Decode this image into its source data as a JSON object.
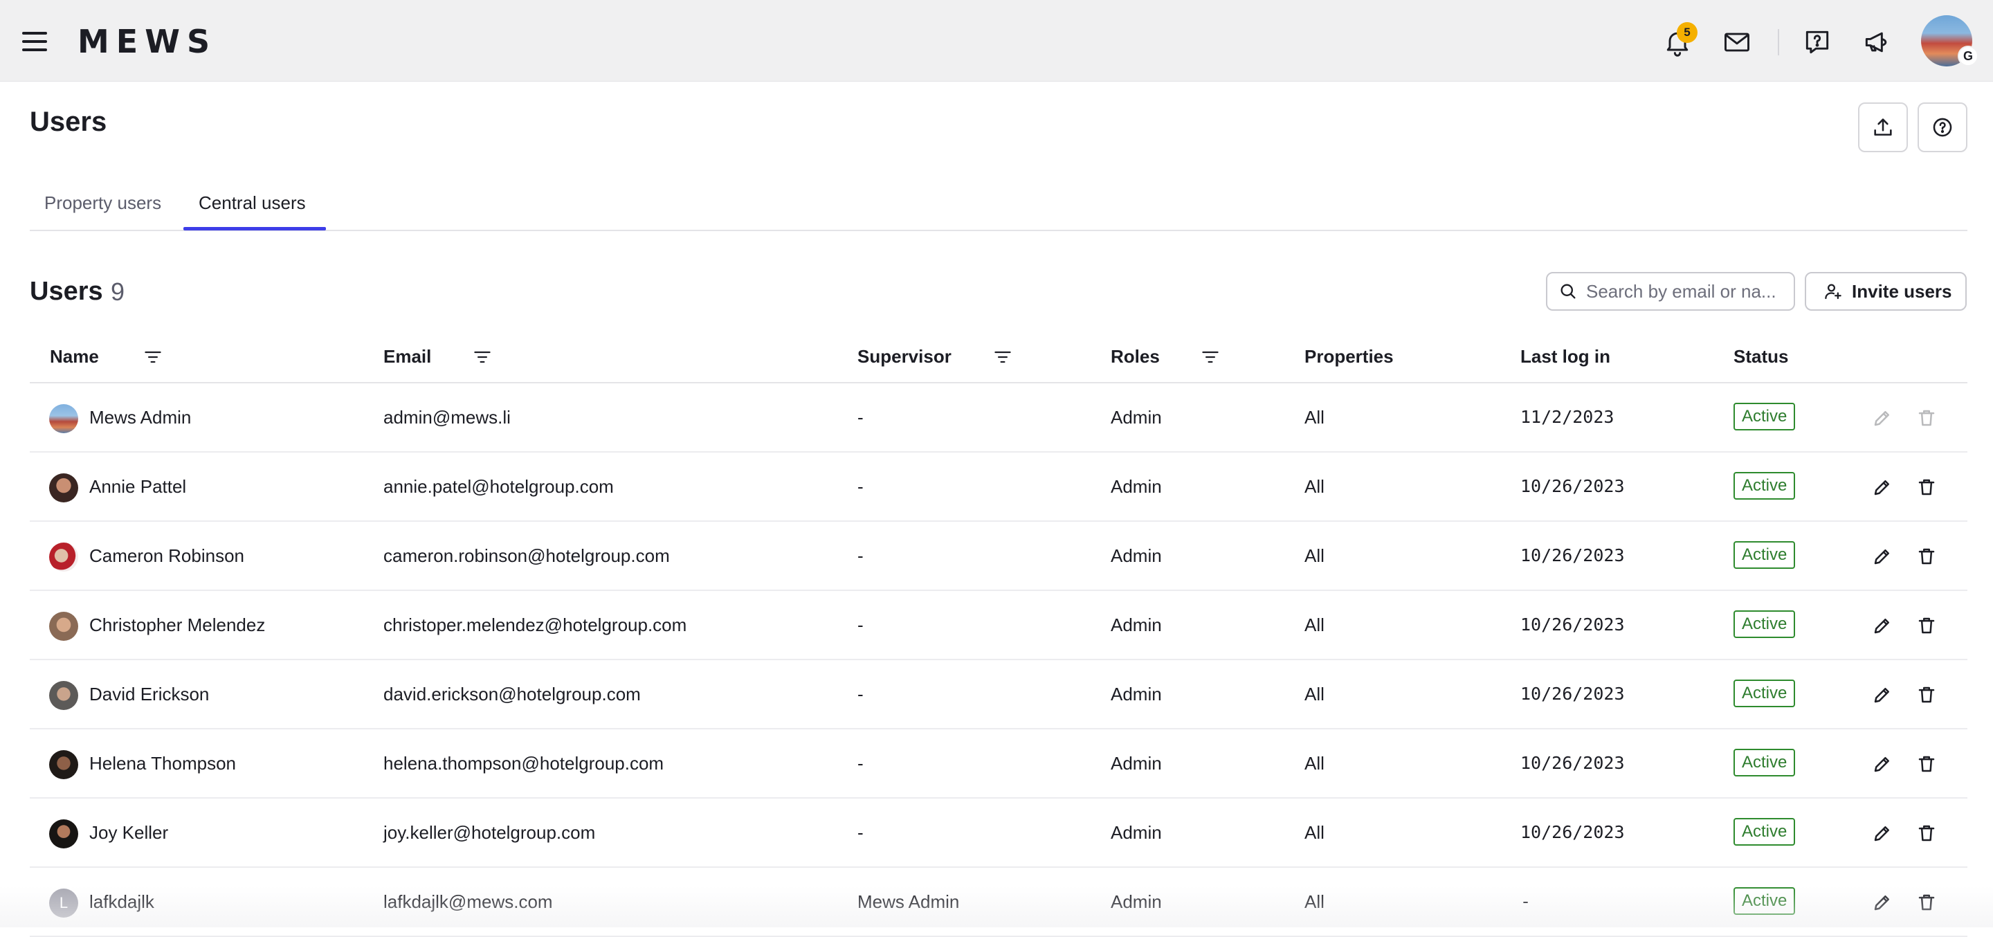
{
  "app": {
    "logo": "MEWS",
    "notification_count": "5",
    "avatar_initial": "G",
    "icons": [
      "menu-icon",
      "bell-icon",
      "mail-icon",
      "help-chat-icon",
      "megaphone-icon"
    ]
  },
  "page": {
    "title": "Users",
    "export_icon": "upload-icon",
    "help_icon": "question-circle-icon"
  },
  "tabs": [
    {
      "label": "Property users",
      "active": false
    },
    {
      "label": "Central users",
      "active": true
    }
  ],
  "section": {
    "title": "Users",
    "count": "9",
    "search_placeholder": "Search by email or na...",
    "invite_label": "Invite users"
  },
  "table": {
    "columns": [
      "Name",
      "Email",
      "Supervisor",
      "Roles",
      "Properties",
      "Last log in",
      "Status"
    ],
    "rows": [
      {
        "name": "Mews Admin",
        "email": "admin@mews.li",
        "supervisor": "-",
        "roles": "Admin",
        "properties": "All",
        "last_login": "11/2/2023",
        "status": "Active",
        "avatar": "photo-hotel",
        "actions_enabled": false
      },
      {
        "name": "Annie Pattel",
        "email": "annie.patel@hotelgroup.com",
        "supervisor": "-",
        "roles": "Admin",
        "properties": "All",
        "last_login": "10/26/2023",
        "status": "Active",
        "avatar": "photo-1",
        "actions_enabled": true
      },
      {
        "name": "Cameron Robinson",
        "email": "cameron.robinson@hotelgroup.com",
        "supervisor": "-",
        "roles": "Admin",
        "properties": "All",
        "last_login": "10/26/2023",
        "status": "Active",
        "avatar": "photo-2",
        "actions_enabled": true
      },
      {
        "name": "Christopher Melendez",
        "email": "christoper.melendez@hotelgroup.com",
        "supervisor": "-",
        "roles": "Admin",
        "properties": "All",
        "last_login": "10/26/2023",
        "status": "Active",
        "avatar": "photo-3",
        "actions_enabled": true
      },
      {
        "name": "David Erickson",
        "email": "david.erickson@hotelgroup.com",
        "supervisor": "-",
        "roles": "Admin",
        "properties": "All",
        "last_login": "10/26/2023",
        "status": "Active",
        "avatar": "photo-4",
        "actions_enabled": true
      },
      {
        "name": "Helena Thompson",
        "email": "helena.thompson@hotelgroup.com",
        "supervisor": "-",
        "roles": "Admin",
        "properties": "All",
        "last_login": "10/26/2023",
        "status": "Active",
        "avatar": "photo-5",
        "actions_enabled": true
      },
      {
        "name": "Joy Keller",
        "email": "joy.keller@hotelgroup.com",
        "supervisor": "-",
        "roles": "Admin",
        "properties": "All",
        "last_login": "10/26/2023",
        "status": "Active",
        "avatar": "photo-6",
        "actions_enabled": true
      },
      {
        "name": "lafkdajlk",
        "email": "lafkdajlk@mews.com",
        "supervisor": "Mews Admin",
        "roles": "Admin",
        "properties": "All",
        "last_login": "-",
        "status": "Active",
        "avatar": "initial",
        "avatar_initial": "L",
        "actions_enabled": true
      }
    ]
  },
  "colors": {
    "accent": "#3d3de8",
    "active_green": "#2e7d2e",
    "badge_yellow": "#f5b000",
    "topbar_bg": "#f0f0f1"
  }
}
